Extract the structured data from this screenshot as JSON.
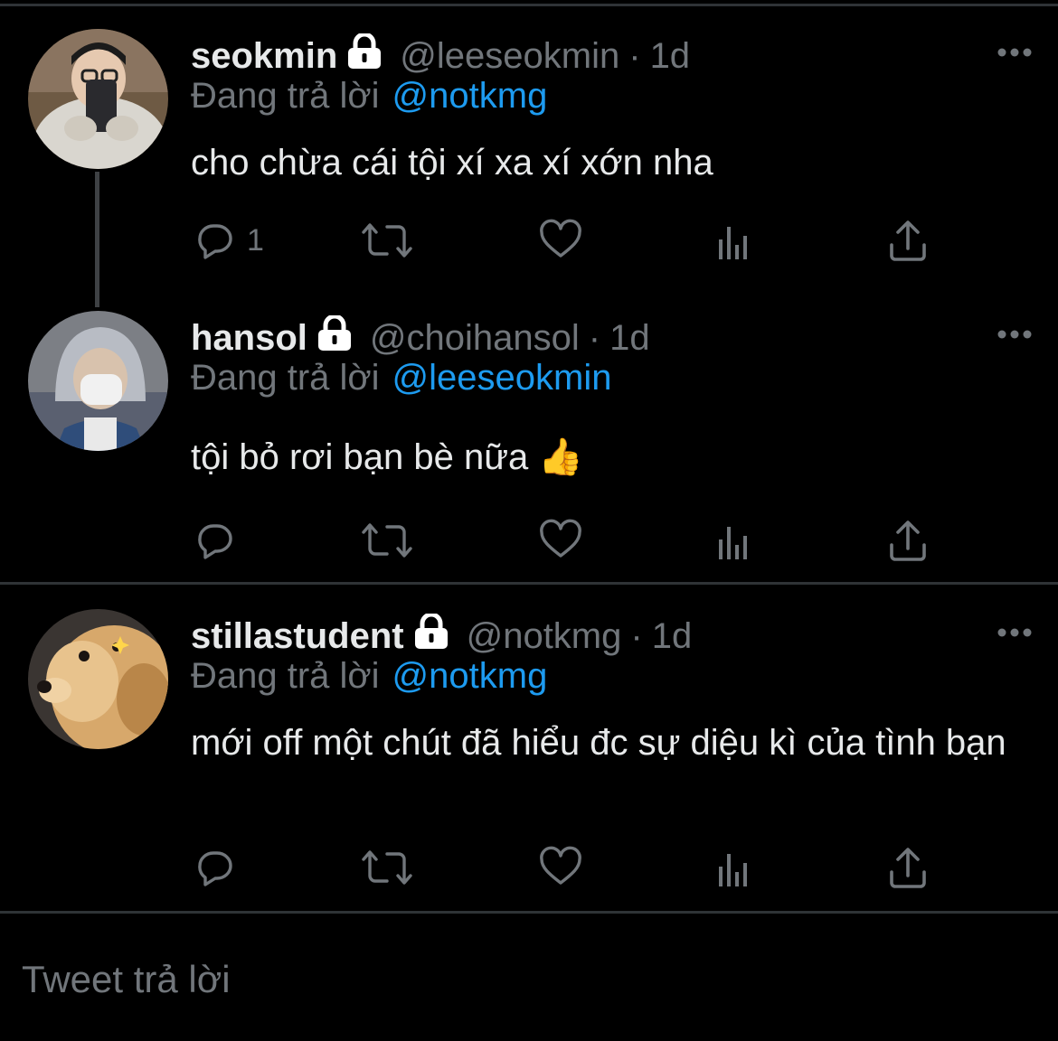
{
  "tweets": [
    {
      "name": "seokmin",
      "handle": "@leeseokmin",
      "sep": "·",
      "time": "1d",
      "replying_prefix": "Đang trả lời",
      "replying_to": "@notkmg",
      "text": "cho chừa cái tội xí xa xí xớn nha",
      "reply_count": "1"
    },
    {
      "name": "hansol",
      "handle": "@choihansol",
      "sep": "·",
      "time": "1d",
      "replying_prefix": "Đang trả lời",
      "replying_to": "@leeseokmin",
      "text": "tội bỏ rơi bạn bè nữa 👍",
      "reply_count": ""
    },
    {
      "name": "stillastudent",
      "handle": "@notkmg",
      "sep": "·",
      "time": "1d",
      "replying_prefix": "Đang trả lời",
      "replying_to": "@notkmg",
      "text": "mới off một chút đã hiểu đc sự diệu kì của tình bạn",
      "reply_count": ""
    }
  ],
  "icons": {
    "lock": "lock-icon",
    "more": "more-icon",
    "reply": "reply-icon",
    "retweet": "retweet-icon",
    "like": "heart-icon",
    "views": "views-icon",
    "share": "share-icon"
  },
  "compose": {
    "placeholder": "Tweet trả lời"
  },
  "colors": {
    "background": "#000000",
    "text": "#e7e9ea",
    "muted": "#71767b",
    "link": "#1d9bf0",
    "divider": "#2f3336"
  }
}
